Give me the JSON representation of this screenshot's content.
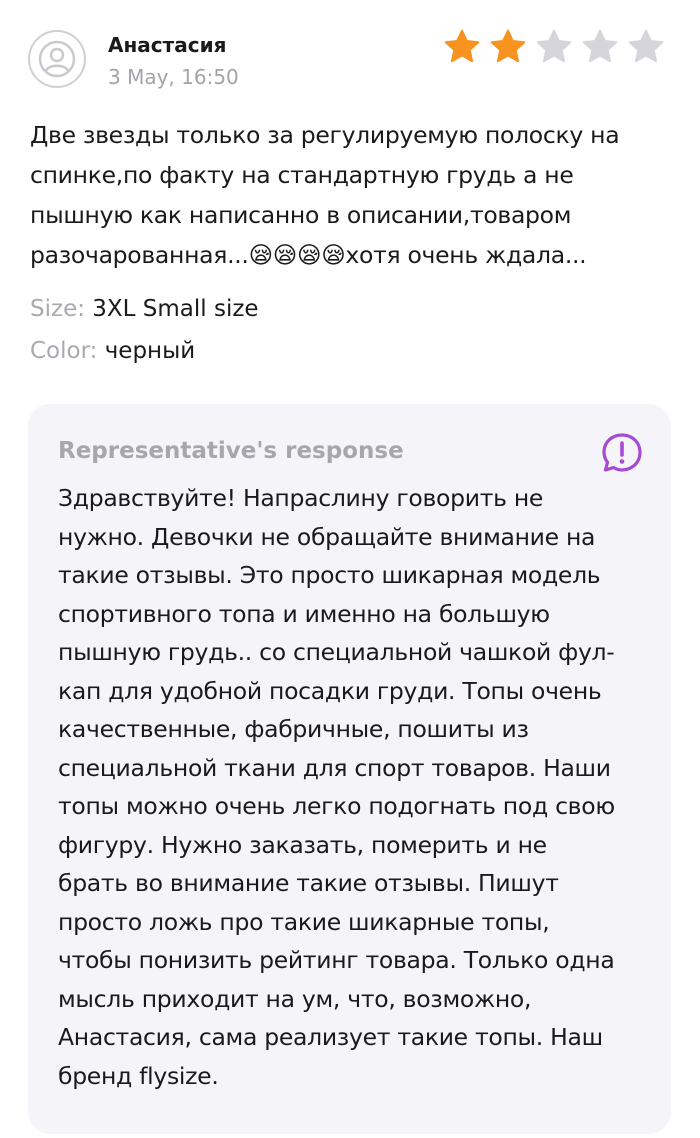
{
  "review": {
    "author": "Анастасия",
    "date": "3 May, 16:50",
    "rating": 2,
    "rating_max": 5,
    "text": "Две звезды только за регулируемую полоску на\nспинке,по факту на стандартную грудь а не\nпышную как написанно в описании,товаром\nразочарованная...😪😪😪😪хотя очень ждала...",
    "size_label": "Size:",
    "size_value": "3XL Small size",
    "color_label": "Color:",
    "color_value": "черный"
  },
  "response": {
    "title": "Representative's response",
    "text": "Здравствуйте!  Напраслину говорить не\nнужно. Девочки не обращайте внимание на\nтакие отзывы.  Это  просто шикарная модель\nспортивного топа и именно на большую\nпышную грудь.. со специальной чашкой фул-\nкап  для удобной посадки груди. Топы очень\nкачественные, фабричные, пошиты из\nспециальной ткани для спорт товаров. Наши\nтопы можно очень легко подогнать под свою\nфигуру. Нужно заказать,  померить и не\nбрать во внимание такие отзывы. Пишут\nпросто  ложь про такие шикарные топы,\nчтобы понизить рейтинг товара. Только одна\nмысль приходит на ум, что, возможно,\nАнастасия, сама реализует такие топы. Наш\nбренд flysize."
  },
  "icons": {
    "avatar": "user-avatar-icon",
    "star": "star-icon",
    "response": "exclamation-bubble-icon"
  },
  "colors": {
    "star_filled": "#F7931E",
    "star_empty": "#D5D5DB",
    "accent": "#A64BD1",
    "response_bg": "#F5F4F9",
    "muted_text": "#A6A6AD"
  }
}
